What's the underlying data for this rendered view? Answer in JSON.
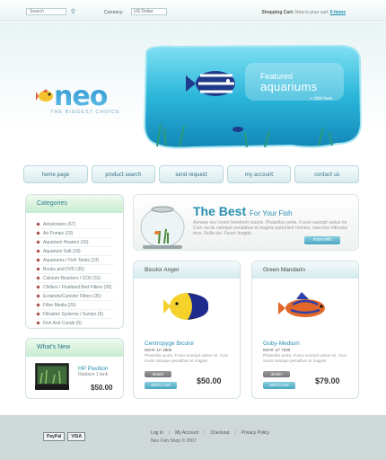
{
  "topbar": {
    "search_placeholder": "Search",
    "currency_label": "Currency:",
    "currency_value": "US Dollar",
    "cart_label": "Shopping Cart:",
    "cart_prefix": "Now in your cart",
    "cart_link": "0 items"
  },
  "logo": {
    "word": "neo",
    "tagline": "THE BIGGEST CHOICE"
  },
  "banner": {
    "line1": "Featured",
    "line2": "aquariums",
    "link": "» click here"
  },
  "nav": [
    {
      "label": "home page"
    },
    {
      "label": "product search"
    },
    {
      "label": "send request"
    },
    {
      "label": "my account"
    },
    {
      "label": "contact us"
    }
  ],
  "categories": {
    "title": "Categories",
    "items": [
      "Aeratorsers (67)",
      "Air Pumps (23)",
      "Aquarium Heaters (16)",
      "Aquarium Salt (19)",
      "Aquariums / Fish Tanks (23)",
      "Books and DVD (35)",
      "Calcium Reactors / CO2 (31)",
      "Chillers / Fluidized Bed Filters (35)",
      "Ecopods/Canister Filters (35)",
      "Filter Media (20)",
      "Filtration Systems / Sumps (9)",
      "Fish And Corals (0)"
    ]
  },
  "whats_new": {
    "title": "What's New",
    "product_name": "HP Pavilion",
    "product_sub": "Replace 1 tank",
    "price": "$50.00"
  },
  "best": {
    "title": "The Best",
    "subtitle": "For Your Fish",
    "text": "Aenean nec lorem hendrerit mauris. Phasellus porta. Fusce suscipit varius mi. Cum sociis natoque penatibus et magnis parturient montes, nascetur ridiculus mus. Nulla dui. Fusce feugiat.",
    "button": "more info"
  },
  "products": [
    {
      "category": "Bicolor Angel",
      "name": "Centropyge Bicolor",
      "item": "Item#: LF 3805",
      "desc": "Phasellus porta. Fusce suscipit varius mi. Cum sociis natoque penatibus et magnis",
      "details_label": "details",
      "cart_label": "add to cart",
      "price": "$50.00"
    },
    {
      "category": "Green Mandarin",
      "name": "Goby-Medium",
      "item": "Item#: LF 7030",
      "desc": "Phasellus porta. Fusce suscipit varius mi. Cum sociis natoque penatibus et magnis",
      "details_label": "details",
      "cart_label": "add to cart",
      "price": "$79.00"
    }
  ],
  "footer": {
    "payments": [
      "PayPal",
      "VISA"
    ],
    "links": [
      "Log In",
      "My Account",
      "Checkout",
      "Privacy Policy"
    ],
    "copyright": "Neo Fish Shop © 2007"
  }
}
